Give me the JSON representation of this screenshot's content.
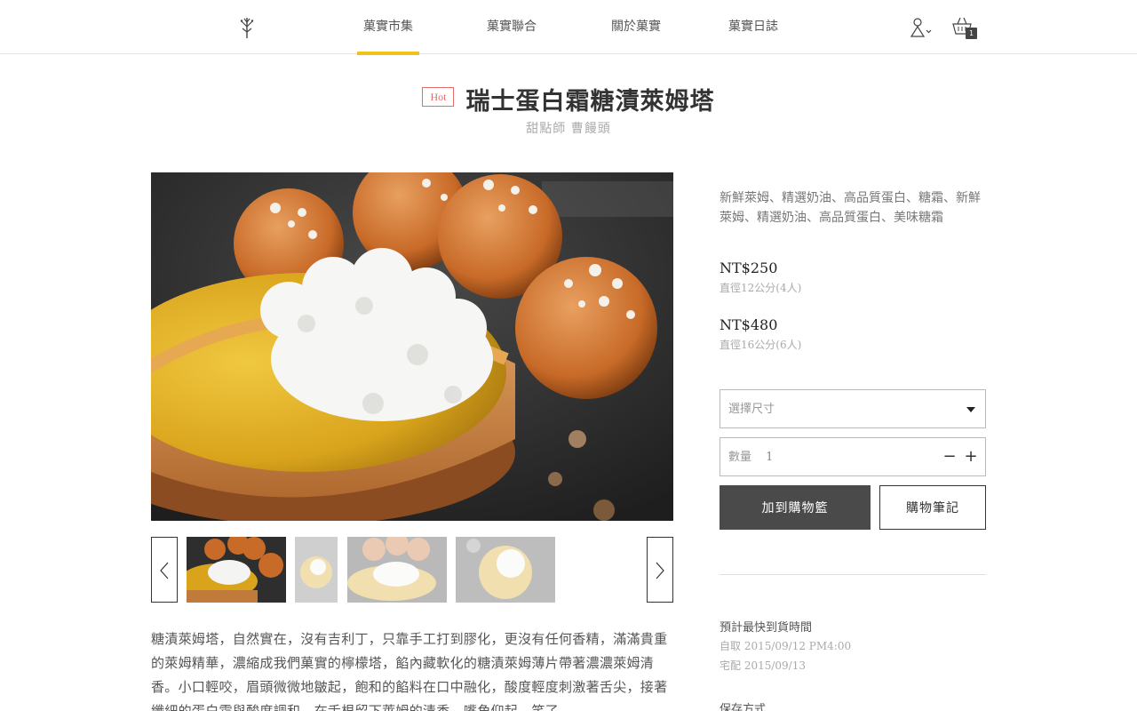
{
  "nav": {
    "items": [
      {
        "label": "菓實市集",
        "active": true
      },
      {
        "label": "菓實聯合",
        "active": false
      },
      {
        "label": "關於菓實",
        "active": false
      },
      {
        "label": "菓實日誌",
        "active": false
      }
    ],
    "cart_count": "1",
    "icons": {
      "logo": "branch-logo-icon",
      "user": "user-icon",
      "cart": "basket-icon"
    }
  },
  "product": {
    "badge": "Hot",
    "title": "瑞士蛋白霜糖漬萊姆塔",
    "subtitle": "甜點師 曹饅頭",
    "ingredients": "新鮮萊姆、精選奶油、高品質蛋白、糖霜、新鮮萊姆、精選奶油、高品質蛋白、美味糖霜",
    "prices": [
      {
        "price": "NT$250",
        "size": "直徑12公分(4人)"
      },
      {
        "price": "NT$480",
        "size": "直徑16公分(6人)"
      }
    ],
    "description": "糖漬萊姆塔，自然實在，沒有吉利丁，只靠手工打到膠化，更沒有任何香精，滿滿貴重的萊姆精華，濃縮成我們菓實的檸檬塔，餡內藏軟化的糖漬萊姆薄片帶著濃濃萊姆清香。小口輕咬，眉頭微微地皺起，飽和的餡料在口中融化，酸度輕度刺激著舌尖，接著纖細的蛋白霜與酸度調和，在舌根留下萊姆的清香，嘴角仰起，笑了。"
  },
  "purchase": {
    "size_placeholder": "選擇尺寸",
    "qty_label": "數量",
    "qty_value": "1",
    "add_to_cart": "加到購物籃",
    "cart_note": "購物筆記"
  },
  "delivery": {
    "title": "預計最快到貨時間",
    "pickup": "自取 2015/09/12 PM4:00",
    "home": "宅配 2015/09/13"
  },
  "storage": {
    "title": "保存方式"
  },
  "colors": {
    "accent": "#f1c21b",
    "hot": "#e06c6c",
    "button_dark": "#4a4a4a"
  }
}
